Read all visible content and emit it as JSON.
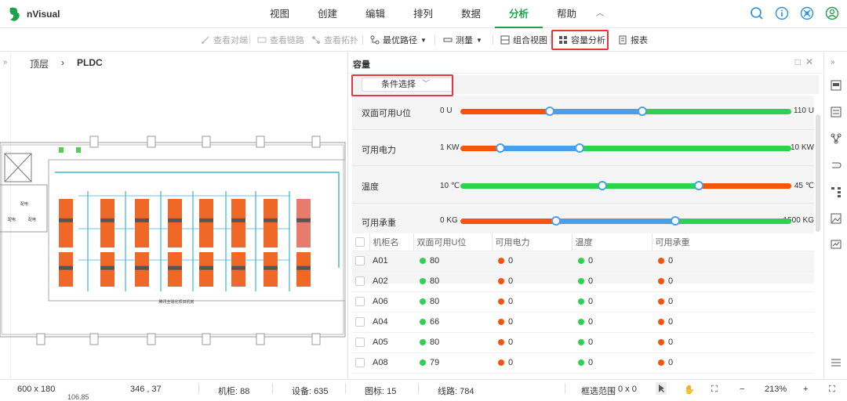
{
  "app": {
    "name": "nVisual",
    "brand_color": "#1aa34a"
  },
  "menu": {
    "items": [
      "视图",
      "创建",
      "编辑",
      "排列",
      "数据",
      "分析",
      "帮助"
    ],
    "active": "分析",
    "icons": [
      "search-icon",
      "info-icon",
      "network-icon",
      "user-icon"
    ]
  },
  "toolbar": {
    "items": [
      {
        "label": "查看对端",
        "enabled": false
      },
      {
        "label": "查看链路",
        "enabled": false
      },
      {
        "label": "查看拓扑",
        "enabled": false
      },
      {
        "label": "最优路径",
        "enabled": true
      },
      {
        "label": "测量",
        "enabled": true
      },
      {
        "label": "组合视图",
        "enabled": true
      },
      {
        "label": "容量分析",
        "enabled": true
      },
      {
        "label": "报表",
        "enabled": true
      }
    ]
  },
  "breadcrumb": {
    "root": "顶层",
    "current": "PLDC"
  },
  "floor": {
    "footer_label": "腾讯全球化项目机房"
  },
  "panel": {
    "title": "容量",
    "condition_select": "条件选择"
  },
  "sliders": [
    {
      "label": "双面可用U位",
      "min": "0 U",
      "max": "110 U",
      "low": 0.27,
      "high": 0.55,
      "outer_color": "#f4540e",
      "inner_color": "#4a9fe8",
      "inner_only_left": true
    },
    {
      "label": "可用电力",
      "min": "1 KW",
      "max": "10 KW",
      "low": 0.12,
      "high": 0.36,
      "outer_color": "#f4540e",
      "inner_color": "#4a9fe8"
    },
    {
      "label": "温度",
      "min": "10 ℃",
      "max": "45 ℃",
      "low": 0.43,
      "high": 0.72,
      "outer_color": "#2fd151",
      "inner_color": "#2fd151"
    },
    {
      "label": "可用承重",
      "min": "0 KG",
      "max": "1500 KG",
      "low": 0.29,
      "high": 0.65,
      "outer_color": "#f4540e",
      "inner_color": "#4a9fe8"
    }
  ],
  "table": {
    "columns": [
      "机柜名",
      "双面可用U位",
      "可用电力",
      "温度",
      "可用承重"
    ],
    "rows": [
      {
        "name": "A01",
        "u": "80",
        "u_color": "#2fd151",
        "power": "0",
        "power_color": "#f4540e",
        "temp": "0",
        "temp_color": "#2fd151",
        "weight": "0",
        "weight_color": "#f4540e"
      },
      {
        "name": "A02",
        "u": "80",
        "u_color": "#2fd151",
        "power": "0",
        "power_color": "#f4540e",
        "temp": "0",
        "temp_color": "#2fd151",
        "weight": "0",
        "weight_color": "#f4540e"
      },
      {
        "name": "A06",
        "u": "80",
        "u_color": "#2fd151",
        "power": "0",
        "power_color": "#f4540e",
        "temp": "0",
        "temp_color": "#2fd151",
        "weight": "0",
        "weight_color": "#f4540e"
      },
      {
        "name": "A04",
        "u": "66",
        "u_color": "#2fd151",
        "power": "0",
        "power_color": "#f4540e",
        "temp": "0",
        "temp_color": "#2fd151",
        "weight": "0",
        "weight_color": "#f4540e"
      },
      {
        "name": "A05",
        "u": "80",
        "u_color": "#2fd151",
        "power": "0",
        "power_color": "#f4540e",
        "temp": "0",
        "temp_color": "#2fd151",
        "weight": "0",
        "weight_color": "#f4540e"
      },
      {
        "name": "A08",
        "u": "79",
        "u_color": "#2fd151",
        "power": "0",
        "power_color": "#f4540e",
        "temp": "0",
        "temp_color": "#2fd151",
        "weight": "0",
        "weight_color": "#f4540e"
      }
    ]
  },
  "status": {
    "size": "600 x 180",
    "coords": "346 , 37",
    "cabinets": "机柜: 88",
    "devices": "设备: 635",
    "icons": "图标: 15",
    "lines": "线路: 784",
    "selection_label": "框选范围",
    "selection_value": "0 x 0",
    "zoom": "213%",
    "cutoff": "106.85"
  }
}
